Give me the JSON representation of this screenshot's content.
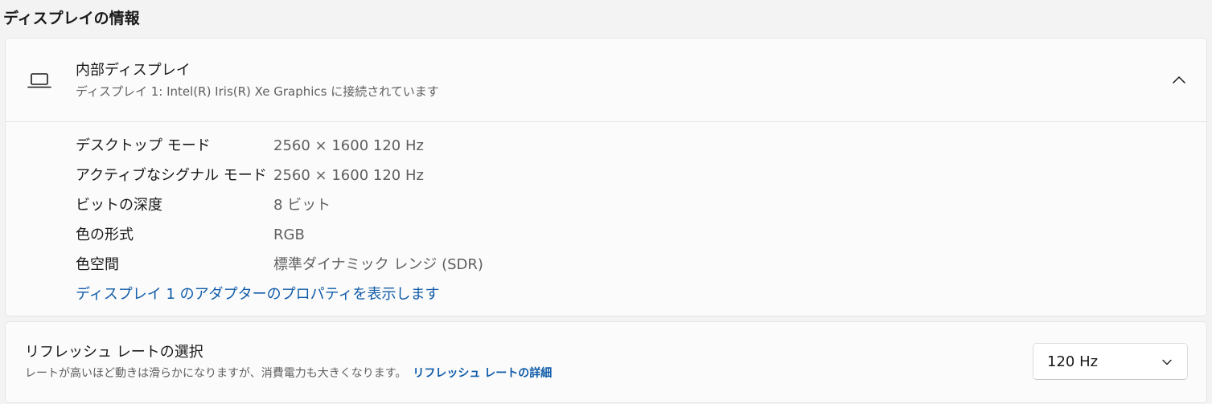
{
  "section": {
    "title": "ディスプレイの情報"
  },
  "display": {
    "icon": "laptop-icon",
    "title": "内部ディスプレイ",
    "subtitle": "ディスプレイ 1: Intel(R) Iris(R) Xe Graphics に接続されています",
    "expanded": true,
    "details": [
      {
        "label": "デスクトップ モード",
        "value": "2560 × 1600 120 Hz"
      },
      {
        "label": "アクティブなシグナル モード",
        "value": "2560 × 1600 120 Hz"
      },
      {
        "label": "ビットの深度",
        "value": "8 ビット"
      },
      {
        "label": "色の形式",
        "value": "RGB"
      },
      {
        "label": "色空間",
        "value": "標準ダイナミック レンジ (SDR)"
      }
    ],
    "adapter_link": "ディスプレイ 1 のアダプターのプロパティを表示します"
  },
  "refresh": {
    "title": "リフレッシュ レートの選択",
    "description": "レートが高いほど動きは滑らかになりますが、消費電力も大きくなります。",
    "link": "リフレッシュ レートの詳細",
    "selected": "120 Hz"
  },
  "colors": {
    "background": "#f3f3f3",
    "card": "#fbfbfb",
    "link": "#0f5ba8",
    "secondary_text": "#5f5f5f"
  }
}
